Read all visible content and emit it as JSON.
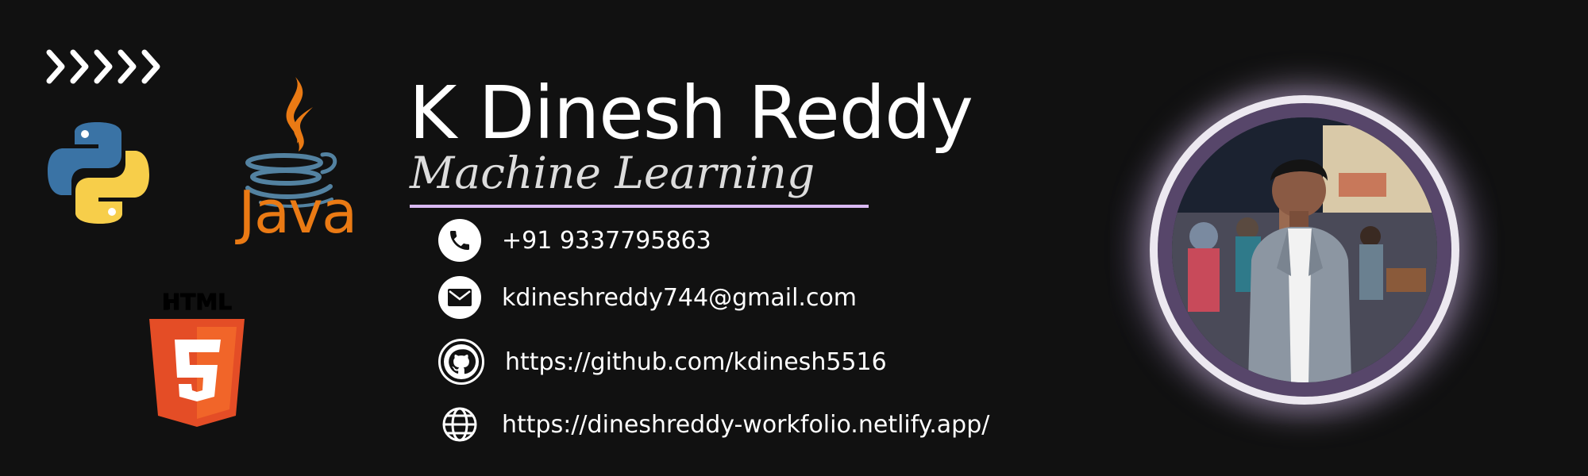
{
  "profile": {
    "name": "K Dinesh Reddy",
    "role": "Machine Learning"
  },
  "logos": {
    "java_text": "Java",
    "html_text": "HTML",
    "html_number": "5"
  },
  "contacts": {
    "phone": "+91 9337795863",
    "email": "kdineshreddy744@gmail.com",
    "github": "https://github.com/kdinesh5516",
    "website": "https://dineshreddy-workfolio.netlify.app/"
  },
  "colors": {
    "background": "#111111",
    "accent_underline": "#D9B9F2",
    "java_orange": "#EA7A14",
    "html_orange": "#E44D26",
    "python_blue": "#3A73A5",
    "python_yellow": "#F7CE4A",
    "photo_ring": "#ECE8F0"
  },
  "icons": [
    "chevrons-icon",
    "python-logo-icon",
    "java-logo-icon",
    "html5-logo-icon",
    "phone-icon",
    "mail-icon",
    "github-icon",
    "globe-icon"
  ]
}
